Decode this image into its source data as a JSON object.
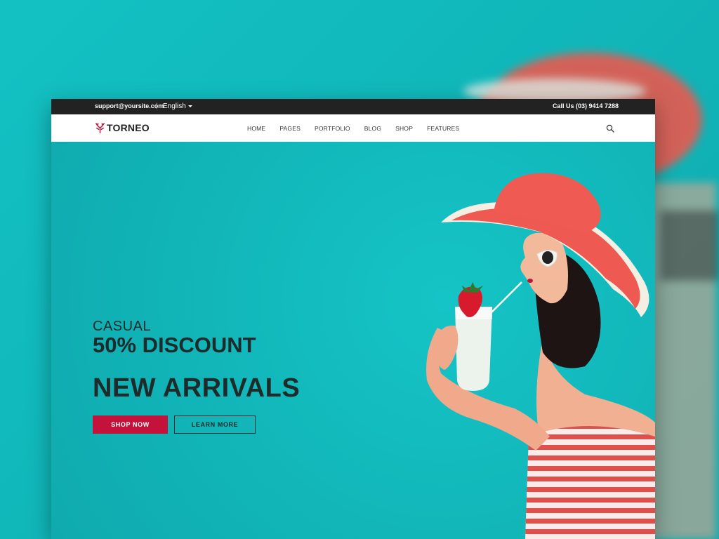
{
  "topbar": {
    "email": "support@yoursite.com",
    "separator": "|",
    "language": "English",
    "phone": "Call Us (03) 9414 7288"
  },
  "navbar": {
    "logo_text": "TORNEO",
    "menu": [
      "HOME",
      "PAGES",
      "PORTFOLIO",
      "BLOG",
      "SHOP",
      "FEATURES"
    ],
    "search_icon": "search-icon"
  },
  "hero": {
    "subtitle": "CASUAL",
    "discount": "50% DISCOUNT",
    "headline": "NEW ARRIVALS",
    "primary_button": "SHOP NOW",
    "secondary_button": "LEARN MORE"
  },
  "colors": {
    "background": "#12b6b9",
    "accent": "#c4123a",
    "topbar": "#222222",
    "hat": "#f0524a"
  }
}
